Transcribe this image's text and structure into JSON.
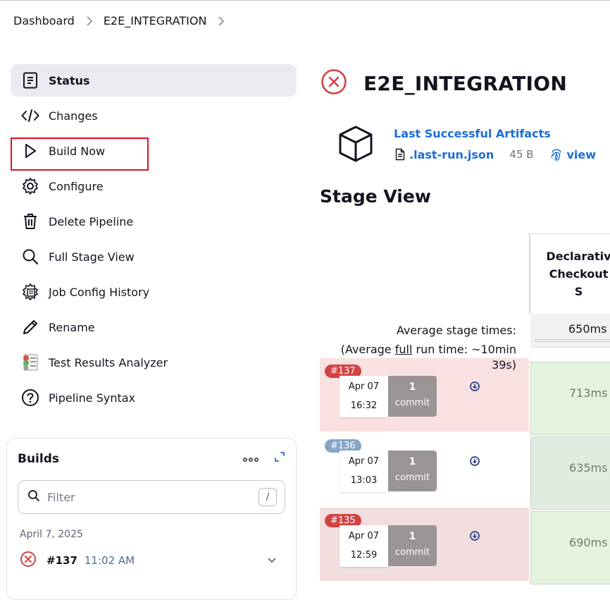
{
  "breadcrumb": {
    "items": [
      "Dashboard",
      "E2E_INTEGRATION"
    ]
  },
  "sidebar": {
    "items": [
      {
        "label": "Status",
        "icon": "document-icon",
        "active": true
      },
      {
        "label": "Changes",
        "icon": "code-icon"
      },
      {
        "label": "Build Now",
        "icon": "play-icon",
        "highlighted": true
      },
      {
        "label": "Configure",
        "icon": "gear-icon"
      },
      {
        "label": "Delete Pipeline",
        "icon": "trash-icon"
      },
      {
        "label": "Full Stage View",
        "icon": "search-icon"
      },
      {
        "label": "Job Config History",
        "icon": "config-history-icon"
      },
      {
        "label": "Rename",
        "icon": "pencil-icon"
      },
      {
        "label": "Test Results Analyzer",
        "icon": "test-results-icon"
      },
      {
        "label": "Pipeline Syntax",
        "icon": "help-icon"
      }
    ]
  },
  "builds": {
    "title": "Builds",
    "filter_placeholder": "Filter",
    "filter_shortcut": "/",
    "date": "April 7, 2025",
    "rows": [
      {
        "number": "#137",
        "time": "11:02 AM",
        "status": "failed"
      }
    ]
  },
  "job": {
    "title": "E2E_INTEGRATION",
    "status": "failed",
    "artifacts_title": "Last Successful Artifacts",
    "artifact_file": ".last-run.json",
    "artifact_size": "45 B",
    "artifact_view": "view"
  },
  "stage_view": {
    "title": "Stage View",
    "stage_header": "Declarative: Checkout S",
    "stage_header_lines": [
      "Declarativ",
      "Checkout S"
    ],
    "avg_label_1": "Average stage times:",
    "avg_label_2_prefix": "(Average ",
    "avg_label_2_full": "full",
    "avg_label_2_suffix": " run time: ~10min",
    "avg_label_3": "39s)",
    "avg_time": "650ms",
    "runs": [
      {
        "badge": "#137",
        "date": "Apr 07",
        "time": "16:32",
        "commits": "1",
        "commit_label": "commit",
        "stage_time": "713ms",
        "status": "failed"
      },
      {
        "badge": "#136",
        "date": "Apr 07",
        "time": "13:03",
        "commits": "1",
        "commit_label": "commit",
        "stage_time": "635ms",
        "status": "success"
      },
      {
        "badge": "#135",
        "date": "Apr 07",
        "time": "12:59",
        "commits": "1",
        "commit_label": "commit",
        "stage_time": "690ms",
        "status": "failed"
      }
    ]
  },
  "colors": {
    "link": "#1a6ed8",
    "failed": "#d24343",
    "highlight": "#e3101b"
  }
}
